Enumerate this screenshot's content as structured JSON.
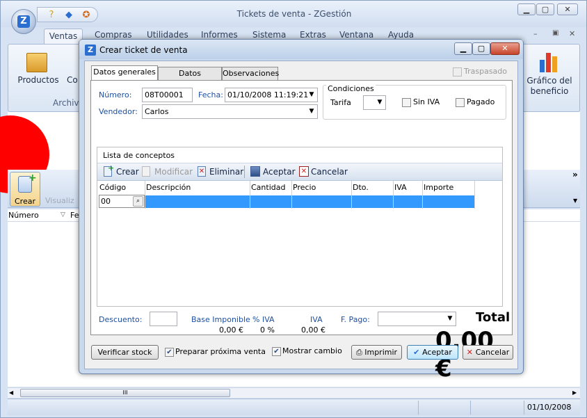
{
  "main_window": {
    "title": "Tickets de venta - ZGestión",
    "app_button_label": "Z",
    "ribbon_tabs": [
      "Ventas",
      "Compras",
      "Utilidades",
      "Informes",
      "Sistema",
      "Extras",
      "Ventana",
      "Ayuda"
    ],
    "ribbon_buttons": {
      "productos": "Productos",
      "con": "Co",
      "archivo": "Archiv",
      "grafico_l1": "Gráfico del",
      "grafico_l2": "beneficio"
    },
    "toolbar": {
      "crear": "Crear",
      "visualizar": "Visualiz",
      "chevron": "»"
    },
    "grid_headers": {
      "numero": "Número",
      "fecha": "Fe"
    },
    "scroll_grip": "III",
    "status_date": "01/10/2008"
  },
  "dialog": {
    "title": "Crear ticket de venta",
    "icon_label": "Z",
    "tabs": [
      "Datos generales",
      "Datos adicionales",
      "Observaciones"
    ],
    "traspasado_label": "Traspasado",
    "numero_label": "Número:",
    "numero_value": "08T00001",
    "fecha_label": "Fecha:",
    "fecha_value": "01/10/2008 11:19:21",
    "vendedor_label": "Vendedor:",
    "vendedor_value": "Carlos",
    "condiciones": {
      "title": "Condiciones",
      "tarifa_label": "Tarifa",
      "sin_iva_label": "Sin IVA",
      "pagado_label": "Pagado"
    },
    "conceptos": {
      "title": "Lista de conceptos",
      "toolbar": {
        "crear": "Crear",
        "modificar": "Modificar",
        "eliminar": "Eliminar",
        "aceptar": "Aceptar",
        "cancelar": "Cancelar"
      },
      "columns": [
        "Código",
        "Descripción",
        "Cantidad",
        "Precio",
        "Dto.",
        "IVA",
        "Importe"
      ],
      "row_code": "00"
    },
    "totals": {
      "descuento_label": "Descuento:",
      "base_label": "Base Imponible",
      "base_value": "0,00 €",
      "piva_label": "% IVA",
      "piva_value": "0 %",
      "iva_label": "IVA",
      "iva_value": "0,00 €",
      "fpago_label": "F. Pago:",
      "total_label": "Total",
      "total_value": "0,00 €"
    },
    "footer": {
      "verificar": "Verificar stock",
      "preparar": "Preparar próxima venta",
      "mostrar": "Mostrar cambio",
      "imprimir": "Imprimir",
      "aceptar": "Aceptar",
      "cancelar": "Cancelar"
    }
  }
}
